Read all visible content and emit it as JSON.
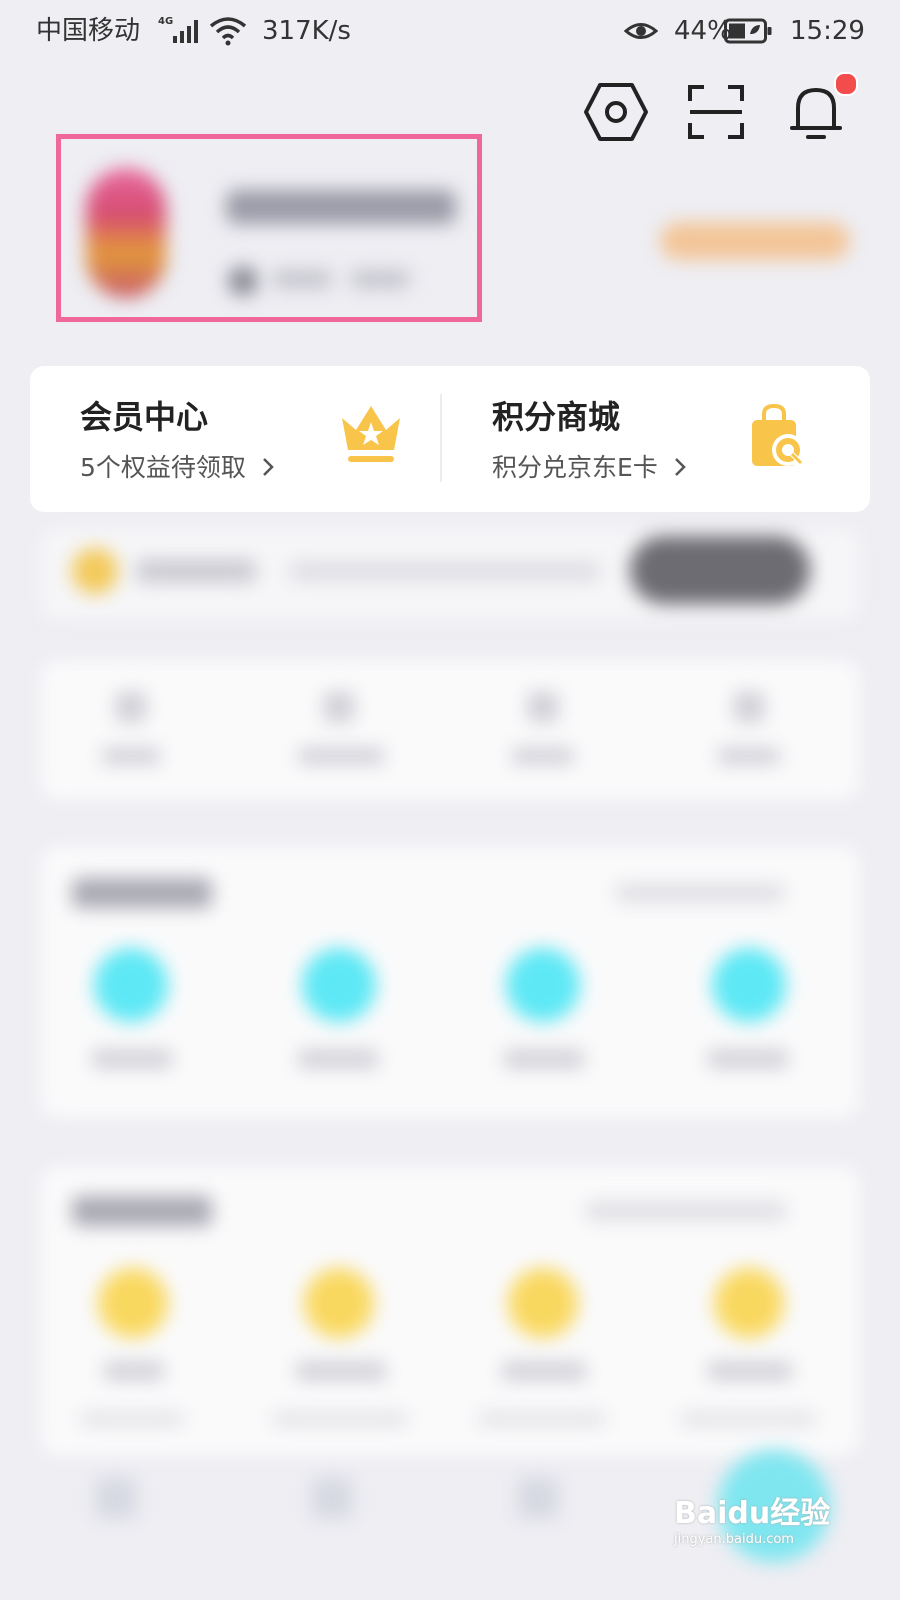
{
  "status_bar": {
    "carrier": "中国移动",
    "network_type": "4G",
    "speed": "317K/s",
    "battery_percent": "44%",
    "time": "15:29"
  },
  "top_icons": [
    "settings-icon",
    "scan-icon",
    "bell-icon"
  ],
  "notification_dot_color": "#f24c4c",
  "highlight_border_color": "#f0679a",
  "member_card": {
    "member_center": {
      "title": "会员中心",
      "subtitle": "5个权益待领取",
      "icon": "crown-icon"
    },
    "points_mall": {
      "title": "积分商城",
      "subtitle": "积分兑京东E卡",
      "icon": "shopping-bag-icon"
    }
  },
  "watermark": {
    "main": "Baidu经验",
    "sub": "jingyan.baidu.com"
  }
}
